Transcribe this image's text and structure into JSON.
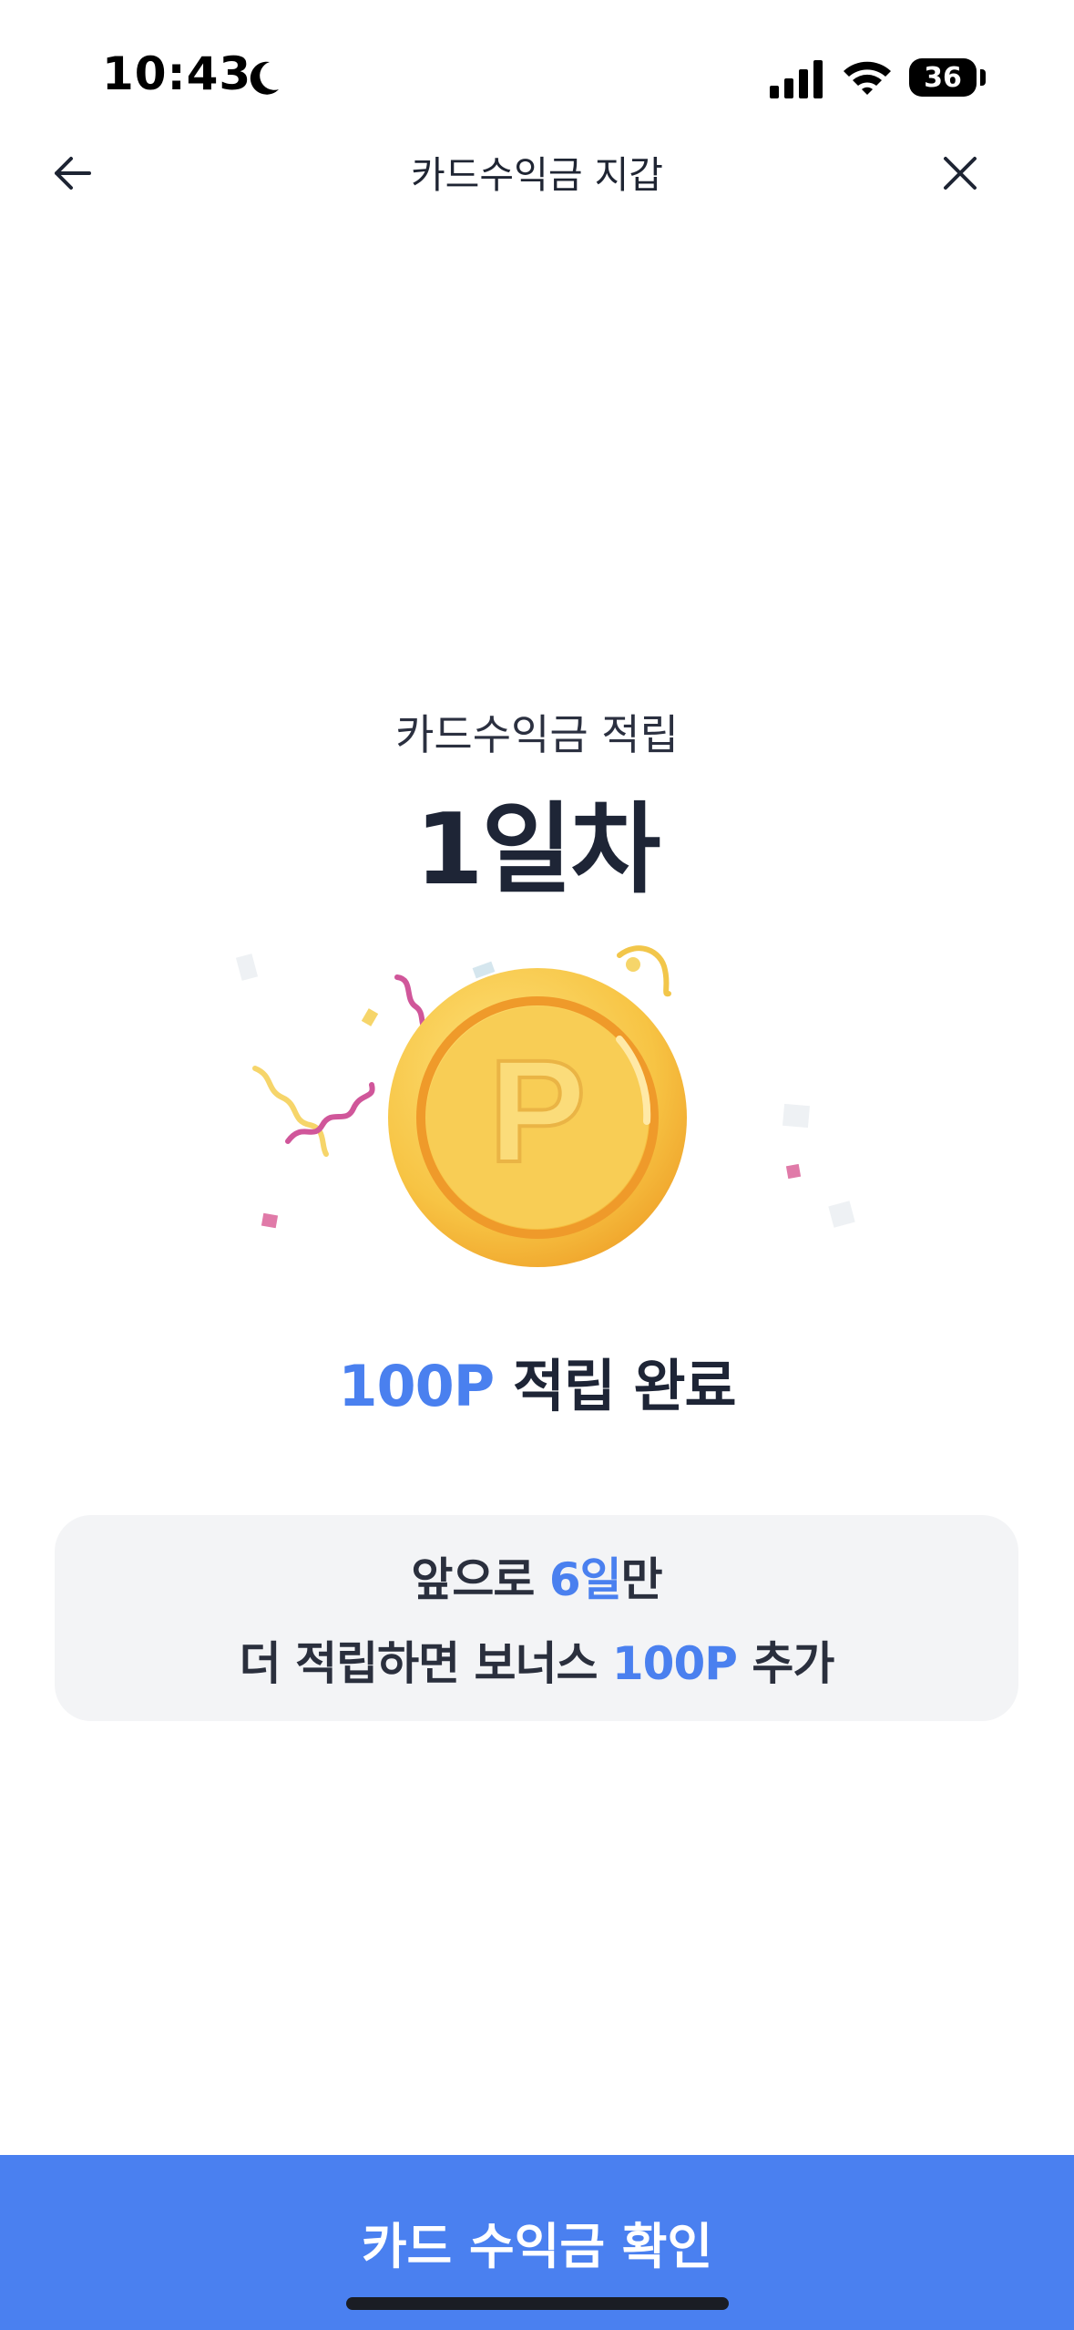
{
  "status_bar": {
    "time": "10:43",
    "battery": "36"
  },
  "header": {
    "title": "카드수익금 지갑"
  },
  "main": {
    "subtitle": "카드수익금 적립",
    "day_label": "1일차",
    "result_points": "100P",
    "result_text": " 적립 완료",
    "coin_letter": "P",
    "bonus": {
      "line1_prefix": "앞으로 ",
      "line1_days": "6일",
      "line1_suffix": "만",
      "line2_prefix": "더 적립하면 보너스 ",
      "line2_points": "100P",
      "line2_suffix": " 추가"
    }
  },
  "footer": {
    "cta_label": "카드 수익금 확인"
  },
  "colors": {
    "accent": "#4a80ef",
    "button": "#4a80f0",
    "coin": "#f7c94c"
  }
}
